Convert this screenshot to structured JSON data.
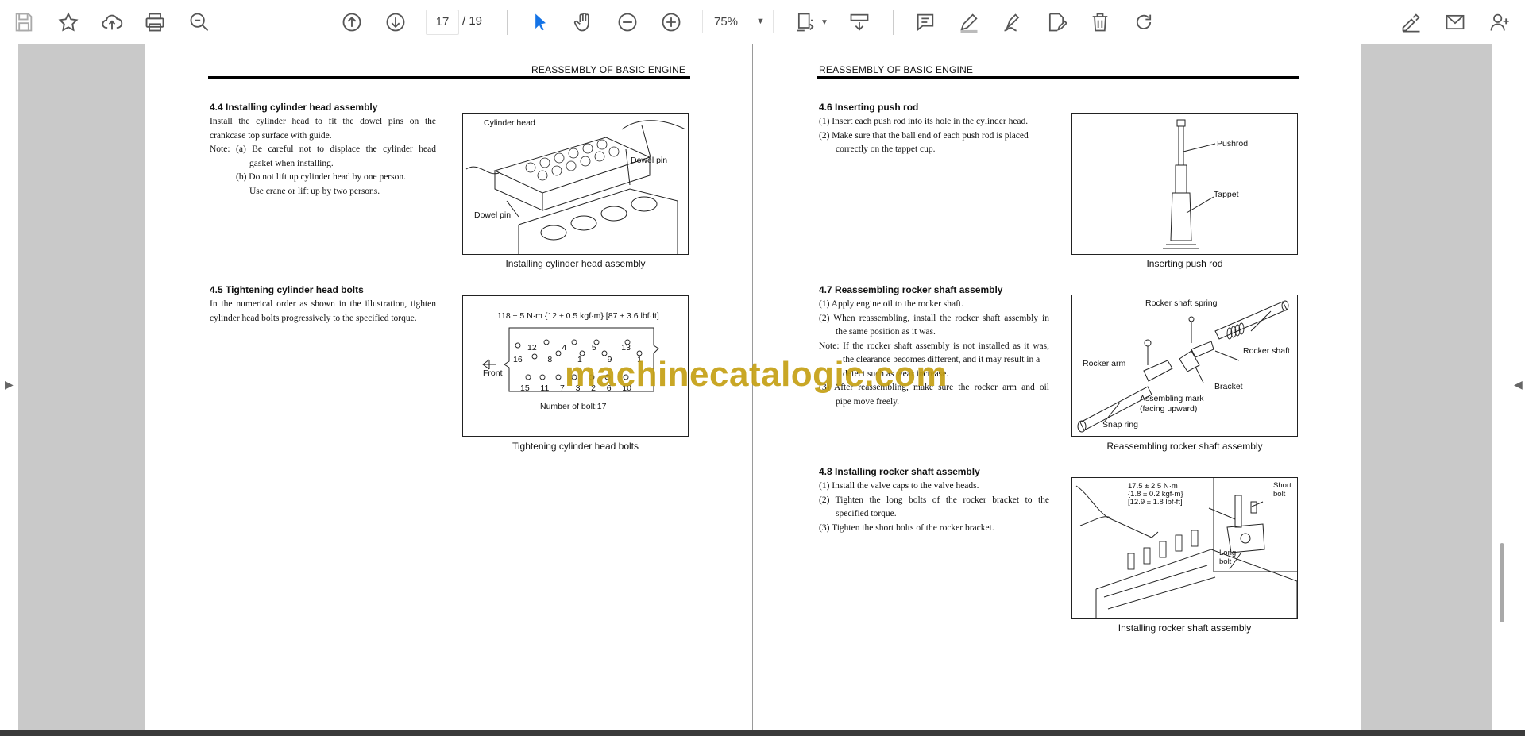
{
  "toolbar": {
    "current_page": "17",
    "page_total": "/ 19",
    "zoom": "75%"
  },
  "left_page": {
    "header": "REASSEMBLY OF BASIC ENGINE",
    "sec44": {
      "title": "4.4   Installing cylinder head assembly",
      "lines": [
        "Install the cylinder head to fit the dowel pins on the",
        "crankcase top surface with guide.",
        "Note:  (a) Be careful not to displace the cylinder head",
        "gasket when installing.",
        "(b) Do not lift up cylinder head by one person.",
        "Use crane or lift up by two persons."
      ],
      "fig_labels": [
        "Cylinder head",
        "Dowel pin",
        "Dowel pin"
      ],
      "caption": "Installing cylinder head assembly"
    },
    "sec45": {
      "title": "4.5   Tightening cylinder head bolts",
      "lines": [
        "In the numerical order as shown in the illustration, tighten",
        "cylinder head bolts progressively to the specified torque."
      ],
      "torque": "118 ± 5 N·m {12 ± 0.5 kgf·m} [87 ± 3.6 lbf·ft]",
      "front_label": "Front",
      "top_numbers": [
        "12",
        "4",
        "5",
        "13"
      ],
      "mid_numbers": [
        "16",
        "8",
        "1",
        "9",
        "1"
      ],
      "bottom_numbers": [
        "15",
        "11",
        "7",
        "3",
        "2",
        "6",
        "10"
      ],
      "bolt_count": "Number of bolt:17",
      "caption": "Tightening cylinder head bolts"
    }
  },
  "right_page": {
    "header": "REASSEMBLY OF BASIC ENGINE",
    "sec46": {
      "title": "4.6   Inserting push rod",
      "lines": [
        "(1)  Insert each push rod into its hole in the cylinder head.",
        "(2)  Make sure that the ball end of each push rod is placed",
        "correctly on the tappet cup."
      ],
      "fig_labels": [
        "Pushrod",
        "Tappet"
      ],
      "caption": "Inserting push rod"
    },
    "sec47": {
      "title": "4.7   Reassembling rocker shaft assembly",
      "lines": [
        "(1)  Apply engine oil to the rocker shaft.",
        "(2)  When reassembling, install the rocker shaft assembly in",
        "the same position as it was.",
        "Note:  If the rocker shaft assembly is not installed as it was,",
        "the clearance becomes different, and it may result in a",
        "defect such as wear increase.",
        "(3)  After reassembling, make sure the rocker arm and oil",
        "pipe move freely."
      ],
      "fig_labels": [
        "Rocker shaft spring",
        "Rocker shaft",
        "Rocker arm",
        "Bracket",
        "Assembling mark",
        "(facing upward)",
        "Snap ring"
      ],
      "caption": "Reassembling rocker shaft assembly"
    },
    "sec48": {
      "title": "4.8   Installing rocker shaft assembly",
      "lines": [
        "(1)  Install the valve caps to the valve heads.",
        "(2)  Tighten the long bolts of the rocker bracket to the",
        "specified torque.",
        "(3)  Tighten the short bolts of the rocker bracket."
      ],
      "torque_lines": [
        "17.5 ± 2.5 N·m",
        "{1.8 ± 0.2 kgf·m}",
        "[12.9 ± 1.8 lbf·ft]"
      ],
      "short_bolt": [
        "Short",
        "bolt"
      ],
      "long_bolt": [
        "Long",
        "bolt"
      ],
      "caption": "Installing rocker shaft assembly"
    }
  },
  "watermark": "machinecatalogic.com"
}
